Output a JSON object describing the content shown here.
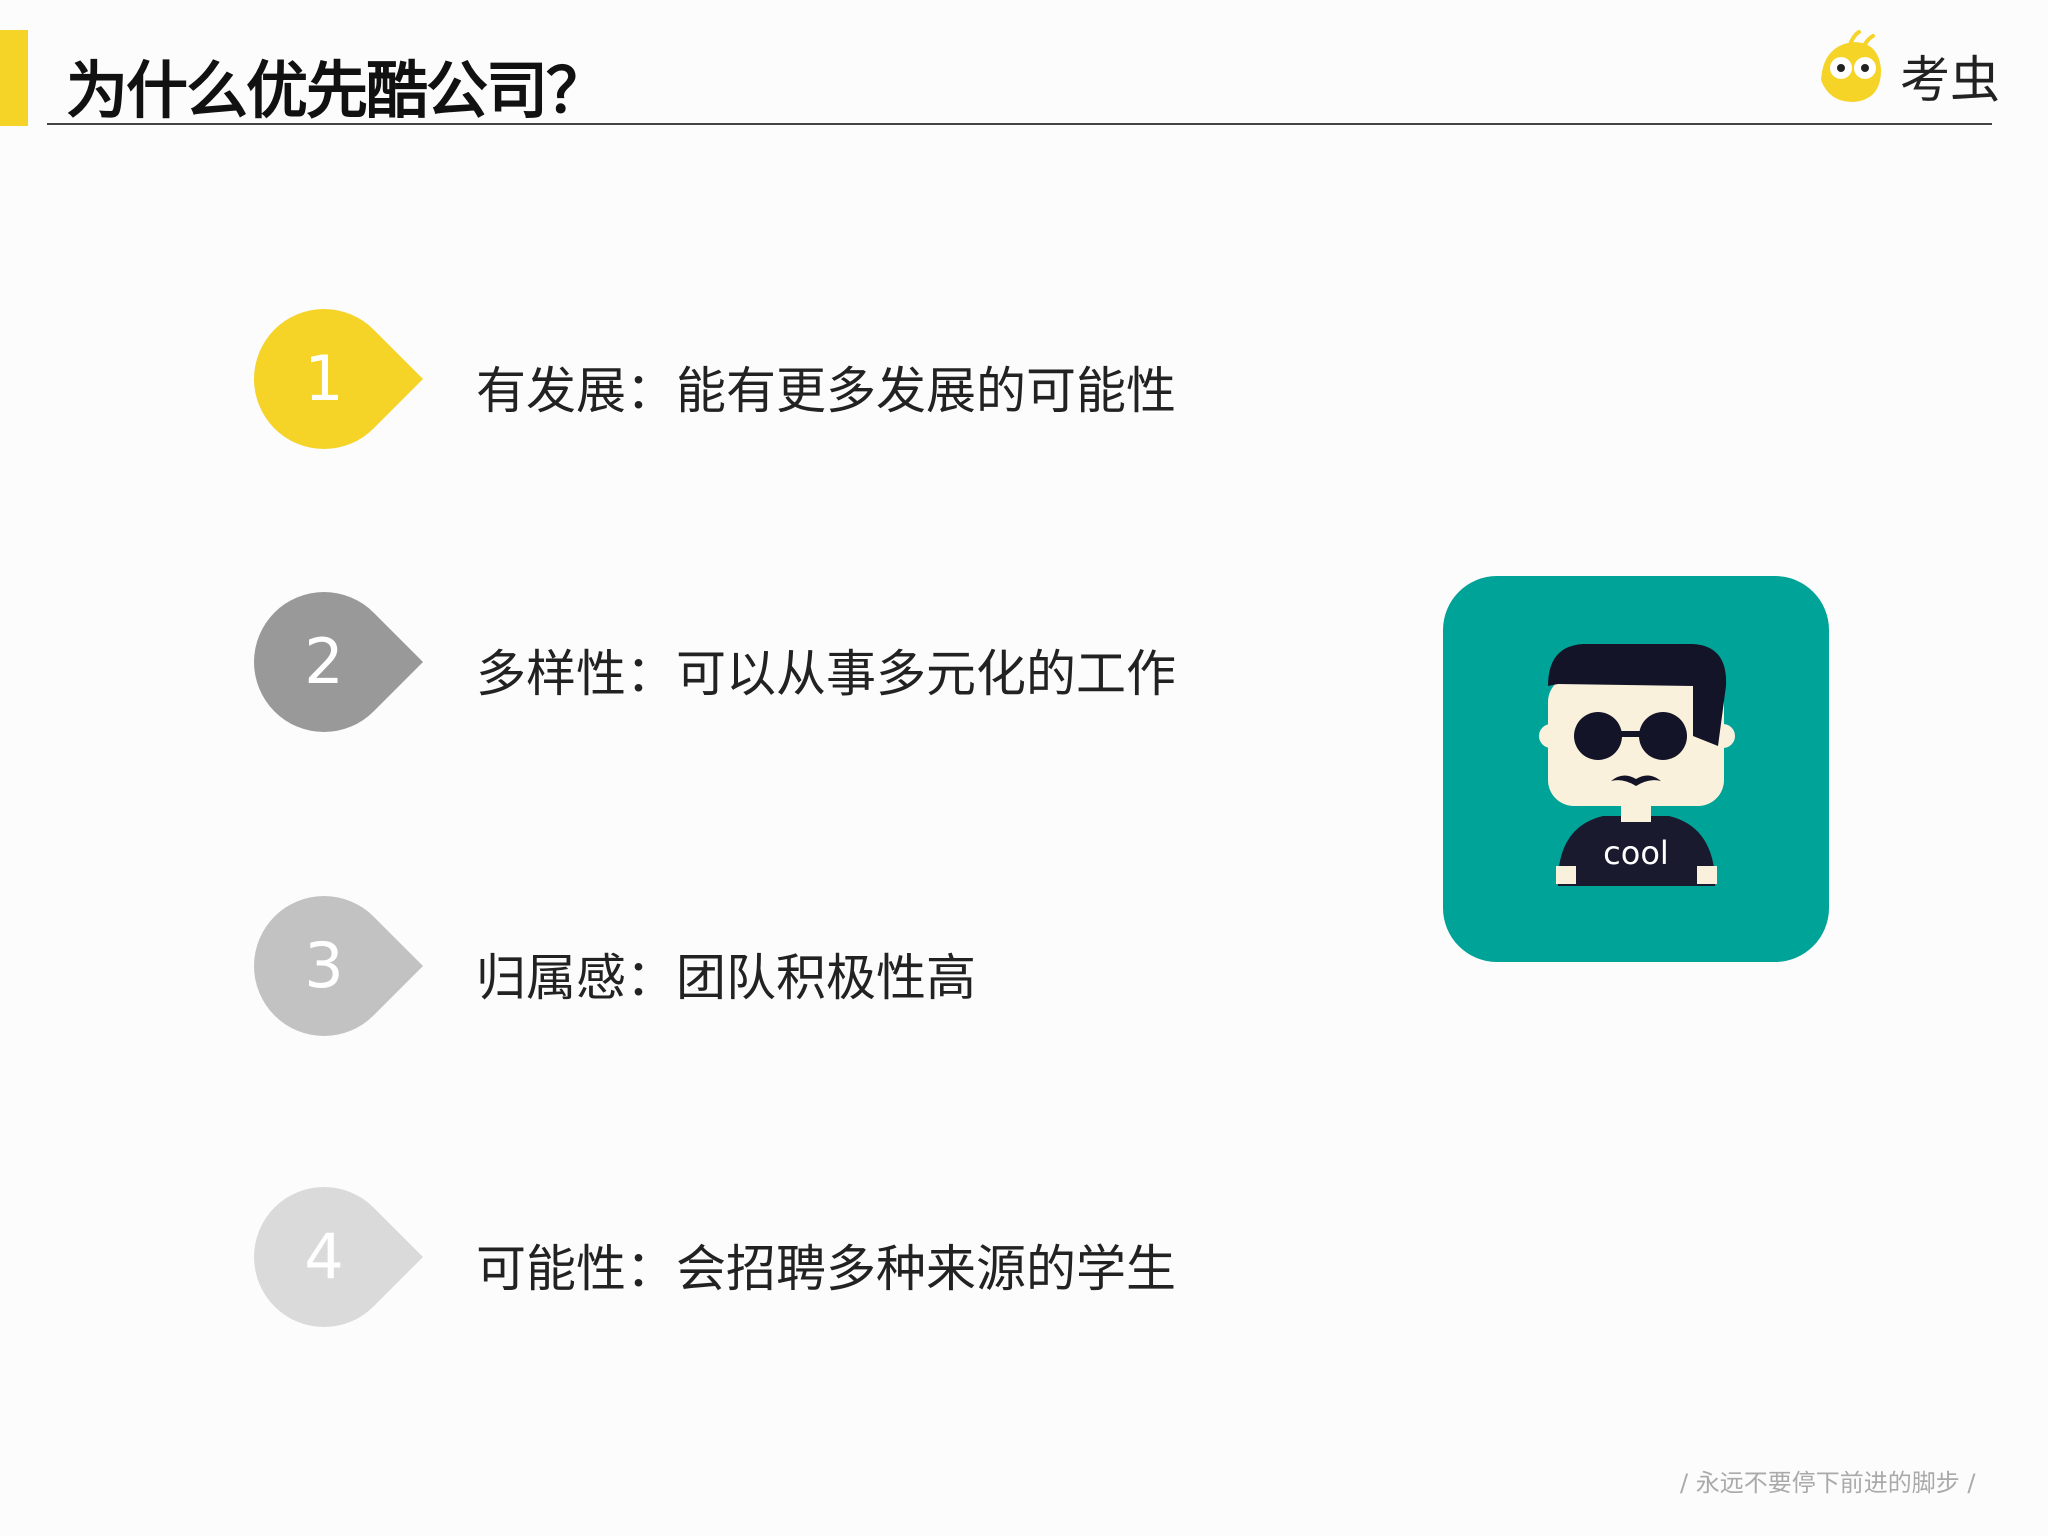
{
  "header": {
    "title": "为什么优先酷公司？",
    "logo_text": "考虫",
    "accent_color": "#f5d327"
  },
  "items": [
    {
      "number": "1",
      "text": "有发展：能有更多发展的可能性",
      "color": "#f5d327"
    },
    {
      "number": "2",
      "text": "多样性：可以从事多元化的工作",
      "color": "#999999"
    },
    {
      "number": "3",
      "text": "归属感：团队积极性高",
      "color": "#c2c2c2"
    },
    {
      "number": "4",
      "text": "可能性：会招聘多种来源的学生",
      "color": "#dadada"
    }
  ],
  "illustration": {
    "shirt_text": "cool",
    "bg_color": "#00a398"
  },
  "footer": {
    "slogan": "/ 永远不要停下前进的脚步 /"
  }
}
